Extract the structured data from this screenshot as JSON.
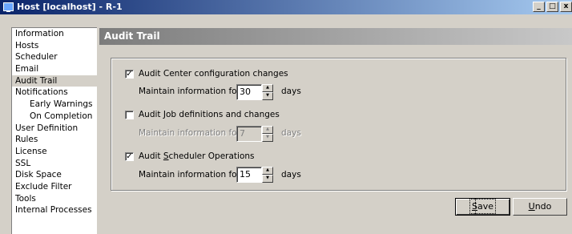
{
  "window": {
    "title": "Host [localhost] - R-1",
    "min_glyph": "_",
    "max_glyph": "□",
    "close_glyph": "x"
  },
  "nav": {
    "items": [
      {
        "label": "Information"
      },
      {
        "label": "Hosts"
      },
      {
        "label": "Scheduler"
      },
      {
        "label": "Email"
      },
      {
        "label": "Audit Trail",
        "selected": true
      },
      {
        "label": "Notifications"
      },
      {
        "label": "Early Warnings",
        "sub": true
      },
      {
        "label": "On Completion",
        "sub": true
      },
      {
        "label": "User Definition"
      },
      {
        "label": "Rules"
      },
      {
        "label": "License"
      },
      {
        "label": "SSL"
      },
      {
        "label": "Disk Space"
      },
      {
        "label": "Exclude Filter"
      },
      {
        "label": "Tools"
      },
      {
        "label": "Internal Processes"
      }
    ]
  },
  "panel": {
    "title": "Audit Trail"
  },
  "audit": {
    "config": {
      "label": "Audit Center configuration changes",
      "checked": true,
      "maintain_label": "Maintain information for",
      "value": "30",
      "days_label": "days"
    },
    "jobs": {
      "label": "Audit Job definitions and changes",
      "checked": false,
      "maintain_label": "Maintain information for",
      "value": "7",
      "days_label": "days"
    },
    "scheduler": {
      "label_pre": "Audit ",
      "label_mnemonic": "S",
      "label_post": "cheduler Operations",
      "checked": true,
      "maintain_label": "Maintain information for",
      "value": "15",
      "days_label": "days"
    }
  },
  "buttons": {
    "save": {
      "mnemonic": "S",
      "rest": "ave"
    },
    "undo": {
      "mnemonic": "U",
      "rest": "ndo"
    }
  },
  "glyphs": {
    "check": "✓",
    "spin_up": "▲",
    "spin_down": "▼"
  }
}
